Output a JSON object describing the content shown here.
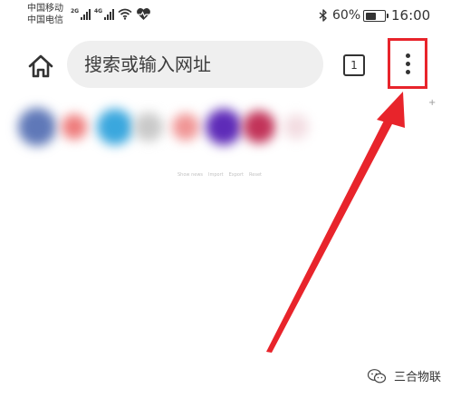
{
  "status_bar": {
    "carrier_1": "中国移动",
    "carrier_2": "中国电信",
    "signal_1_label": "2G",
    "signal_2_label": "4G",
    "battery_percent": "60%",
    "battery_level": 0.6,
    "time": "16:00"
  },
  "toolbar": {
    "search_placeholder": "搜索或输入网址",
    "tab_count": "1"
  },
  "shortcuts": {
    "tiles": [
      {
        "color": "#5f78b8"
      },
      {
        "color": "#ee7b7b"
      },
      {
        "color": "#3aa7de"
      },
      {
        "color": "#c9c9c9"
      },
      {
        "color": "#f09595"
      },
      {
        "color": "#5e2bb8"
      },
      {
        "color": "#c23359"
      },
      {
        "color": "#f3dde2"
      }
    ],
    "add_label": "+"
  },
  "footer_links": [
    "Show news",
    "Import",
    "Export",
    "Reset"
  ],
  "watermark": {
    "text": "三合物联"
  },
  "colors": {
    "annotation_red": "#e8242b",
    "omnibox_bg": "#efefef",
    "icon_dark": "#333333"
  }
}
